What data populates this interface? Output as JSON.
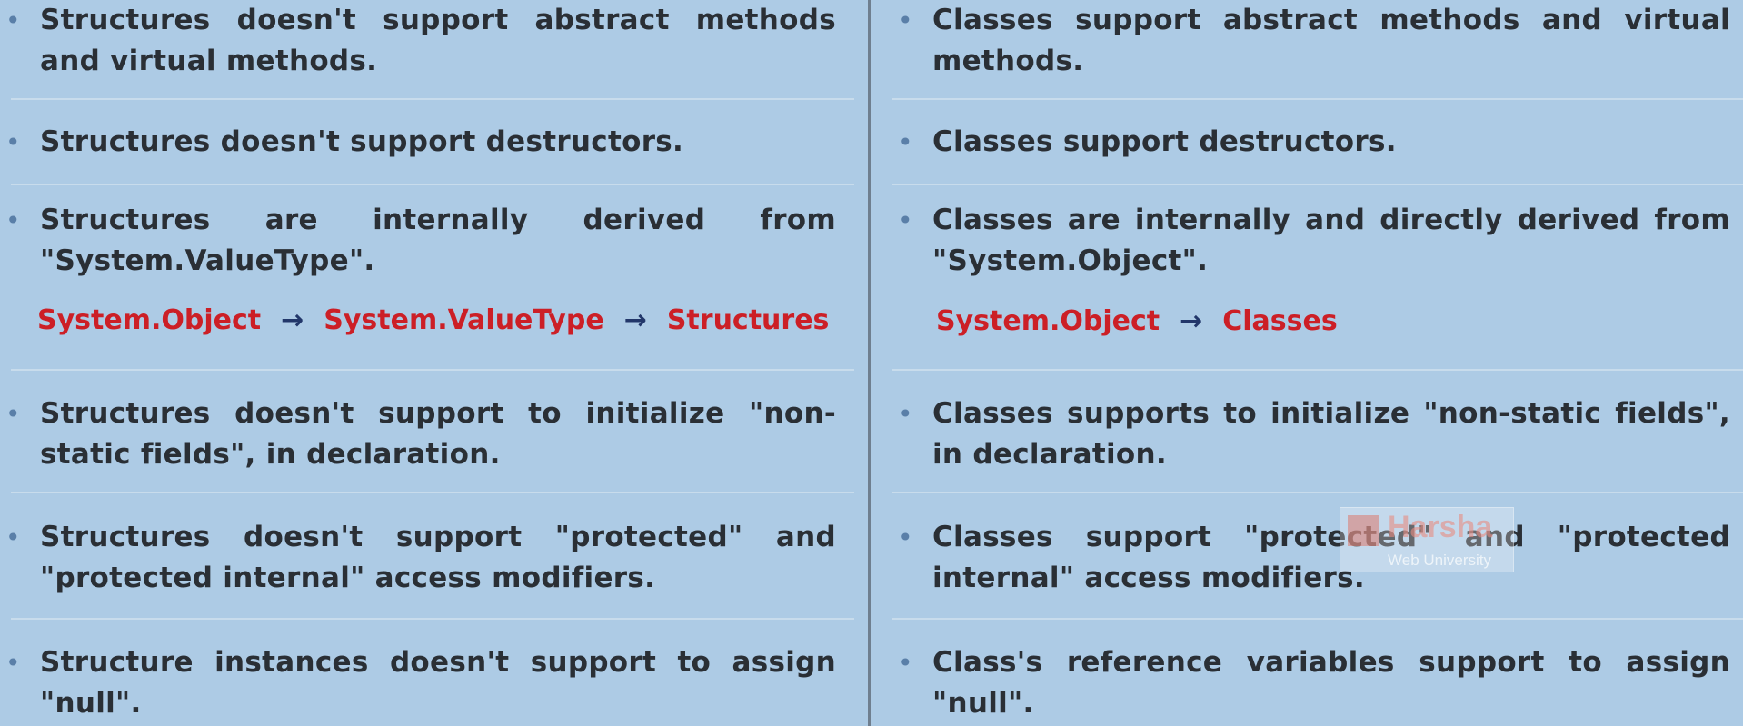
{
  "left": {
    "items": [
      "Structures doesn't support abstract methods and virtual methods.",
      "Structures doesn't support destructors.",
      "Structures are internally derived from \"System.ValueType\".",
      "Structures doesn't support to initialize \"non-static fields\", in declaration.",
      "Structures doesn't support \"protected\" and \"protected internal\" access modifiers.",
      "Structure instances doesn't support to assign \"null\"."
    ],
    "chain": [
      "System.Object",
      "System.ValueType",
      "Structures"
    ]
  },
  "right": {
    "items": [
      "Classes support abstract methods and virtual methods.",
      "Classes support destructors.",
      "Classes are internally and directly derived from \"System.Object\".",
      "Classes supports to initialize \"non-static fields\", in declaration.",
      "Classes support \"protected\" and \"protected internal\" access modifiers.",
      "Class's reference variables support to assign \"null\"."
    ],
    "chain": [
      "System.Object",
      "Classes"
    ]
  },
  "bullet_char": "•",
  "arrow_char": "→",
  "watermark": {
    "name": "Harsha",
    "subtitle": "Web University"
  },
  "colors": {
    "background": "#adcbe5",
    "text": "#2a2f35",
    "accent_red": "#cc1f26",
    "arrow": "#22376a",
    "divider": "#6f7f8f"
  }
}
